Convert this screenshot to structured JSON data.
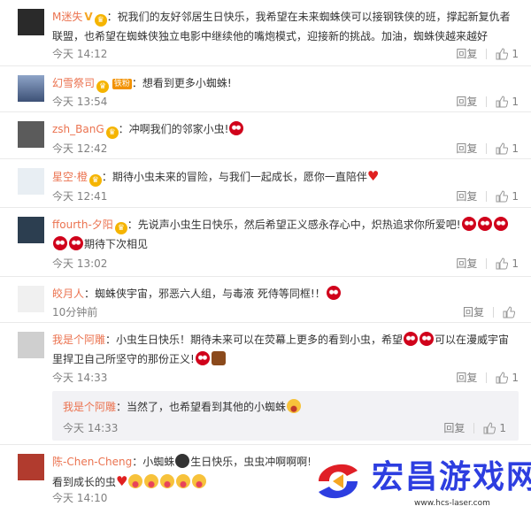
{
  "actions": {
    "reply_label": "回复"
  },
  "comments": [
    {
      "user": "M迷失",
      "text": "：祝我们的友好邻居生日快乐，我希望在未来蜘蛛侠可以接钢铁侠的班，撑起新复仇者联盟，也希望在蜘蛛侠独立电影中继续他的嘴炮模式，迎接新的挑战。加油，蜘蛛侠越来越好",
      "time": "今天 14:12",
      "likes": "1"
    },
    {
      "user": "幻雪祭司",
      "tag": "铁粉",
      "text": "：想看到更多小蜘蛛!",
      "time": "今天 13:54",
      "likes": "1"
    },
    {
      "user": "zsh_BanG",
      "text": "：冲啊我们的邻家小虫!",
      "time": "今天 12:42",
      "likes": "1"
    },
    {
      "user": "星空·橙",
      "text": "：期待小虫未来的冒险，与我们一起成长，愿你一直陪伴",
      "time": "今天 12:41",
      "likes": "1"
    },
    {
      "user": "ffourth-夕阳",
      "text": "：先说声小虫生日快乐，然后希望正义感永存心中，炽热追求你所爱吧!",
      "text2": "期待下次相见",
      "time": "今天 13:02",
      "likes": "1"
    },
    {
      "user": "皎月人",
      "text": "：蜘蛛侠宇宙，邪恶六人组，与毒液 死侍等同框!！",
      "time": "10分钟前",
      "likes": ""
    },
    {
      "user": "我是个阿雕",
      "text": "：小虫生日快乐！期待未来可以在荧幕上更多的看到小虫，希望",
      "text_b": "可以在漫威宇宙里捍卫自己所坚守的那份正义!",
      "time": "今天 14:33",
      "likes": "1",
      "sub": {
        "user": "我是个阿雕",
        "text": "：当然了，也希望看到其他的小蜘蛛",
        "time": "今天 14:33",
        "likes": "1"
      }
    },
    {
      "user": "陈-Chen-Cheng",
      "text": "：小蜘蛛",
      "text_b": "生日快乐，虫虫冲啊啊啊!",
      "text2": "看到成长的虫",
      "time": "今天 14:10",
      "likes": ""
    }
  ],
  "watermark": {
    "title": "宏昌游戏网",
    "url": "www.hcs-laser.com"
  },
  "colors": {
    "username": "#eb7350",
    "watermark": "#2d3ee0",
    "emoji_spider": "#d0021b"
  }
}
